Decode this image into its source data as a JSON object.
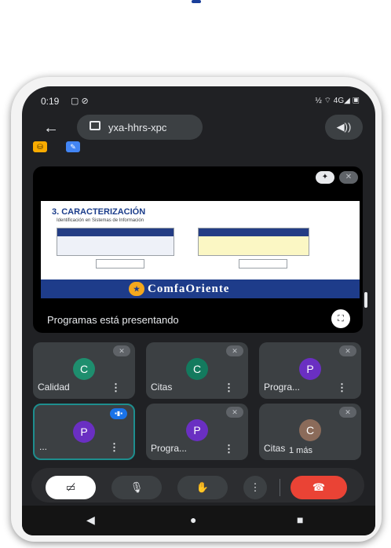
{
  "status_bar": {
    "time": "0:19",
    "left_icons": "▢ ⊘",
    "right_icons": "½ ⌔ 4G◢ ▣"
  },
  "app_bar": {
    "back_glyph": "←",
    "meeting_code": "yxa-hhrs-xpc",
    "audio_glyph": "◀))"
  },
  "toolbar_badges": [
    {
      "name": "captions",
      "glyph": "⛁",
      "color": "#f9ab00"
    },
    {
      "name": "effects",
      "glyph": "✎",
      "color": "#4285f4"
    }
  ],
  "presentation": {
    "slide_title": "3. CARACTERIZACIÓN",
    "slide_subtitle": "Identificación en Sistemas de Información",
    "brand": "ComfaOriente",
    "presenter_text": "Programas está presentando",
    "pin_glyph": "✦",
    "mute_glyph": "✕",
    "fullscreen_glyph": "⛶"
  },
  "participants": [
    {
      "initial": "C",
      "name": "Calidad",
      "avatar_color": "#1e8e6e",
      "speaking": false
    },
    {
      "initial": "C",
      "name": "Citas",
      "avatar_color": "#137a5e",
      "speaking": false
    },
    {
      "initial": "P",
      "name": "Progra...",
      "avatar_color": "#6a2fc2",
      "speaking": false
    },
    {
      "initial": "P",
      "name": "...",
      "avatar_color": "#6a2fc2",
      "speaking": true
    },
    {
      "initial": "P",
      "name": "Progra...",
      "avatar_color": "#6a2fc2",
      "speaking": false
    },
    {
      "initial": "C",
      "name": "Citas",
      "avatar_color": "#8b6b5a",
      "speaking": false
    }
  ],
  "more_participants": "1 más",
  "controls": {
    "camera": "▭̸",
    "mic": "🎙",
    "hand": "✋",
    "more": "⋮",
    "end": "☎"
  },
  "nav": {
    "back": "◀",
    "home": "●",
    "recents": "■"
  }
}
